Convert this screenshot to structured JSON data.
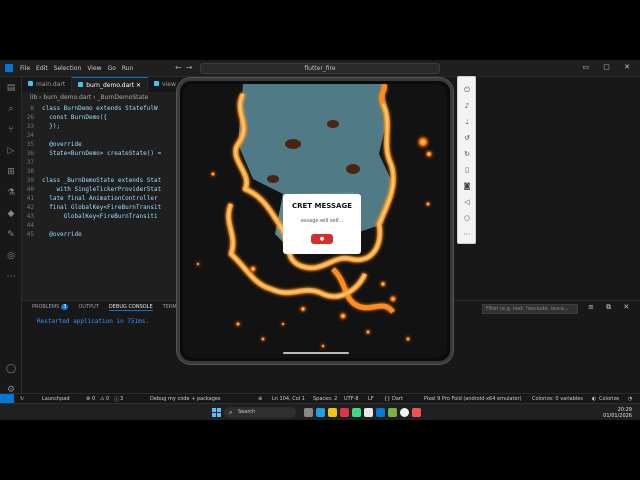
{
  "titlebar": {
    "menu": [
      "File",
      "Edit",
      "Selection",
      "View",
      "Go",
      "Run"
    ],
    "command_center": "flutter_fire"
  },
  "editor": {
    "tabs": [
      "main.dart",
      "burn_demo.dart",
      "view"
    ],
    "breadcrumb": "lib › burn_demo.dart › _BurnDemoState",
    "lines": [
      {
        "n": "8",
        "t": "class BurnDemo extends StatefulW"
      },
      {
        "n": "26",
        "t": "  const BurnDemo({"
      },
      {
        "n": "33",
        "t": "  });"
      },
      {
        "n": "34",
        "t": ""
      },
      {
        "n": "35",
        "t": "  @override"
      },
      {
        "n": "36",
        "t": "  State<BurnDemo> createState() ="
      },
      {
        "n": "37",
        "t": ""
      },
      {
        "n": "38",
        "t": ""
      },
      {
        "n": "39",
        "t": "class _BurnDemoState extends Stat"
      },
      {
        "n": "40",
        "t": "    with SingleTickerProviderStat"
      },
      {
        "n": "41",
        "t": "  late final AnimationController"
      },
      {
        "n": "42",
        "t": "  final GlobalKey<FireBurnTransit"
      },
      {
        "n": "43",
        "t": "      GlobalKey<FireBurnTransiti"
      },
      {
        "n": "44",
        "t": ""
      },
      {
        "n": "45",
        "t": "  @override"
      }
    ]
  },
  "panel": {
    "tabs": [
      "PROBLEMS",
      "OUTPUT",
      "DEBUG CONSOLE",
      "TERMI"
    ],
    "problems_count": "3",
    "console": "Restarted application in 751ms.",
    "filter_placeholder": "Filter (e.g. text, !exclude, \\esca..."
  },
  "app": {
    "dialog_title": "CRET MESSAGE",
    "dialog_body": "essage will self..."
  },
  "statusbar": {
    "launchpad": "Launchpad",
    "problems": "0",
    "warnings": "0",
    "info": "3",
    "debug": "Debug my code + packages",
    "cursor": "Ln 104, Col 1",
    "spaces": "Spaces: 2",
    "encoding": "UTF-8",
    "eol": "LF",
    "language": "Dart",
    "device": "Pixel 9 Pro Fold (android-x64 emulator)",
    "colorize_vars": "Colorize: 0 variables",
    "colorize": "Colorize"
  },
  "taskbar": {
    "search": "Search",
    "time": "20:29",
    "date": "01/01/2026"
  },
  "colors": {
    "accent": "#0078d4",
    "fire": "#ff8c1a",
    "dialog_button": "#d32f2f",
    "app_background": "#4f7a86"
  }
}
